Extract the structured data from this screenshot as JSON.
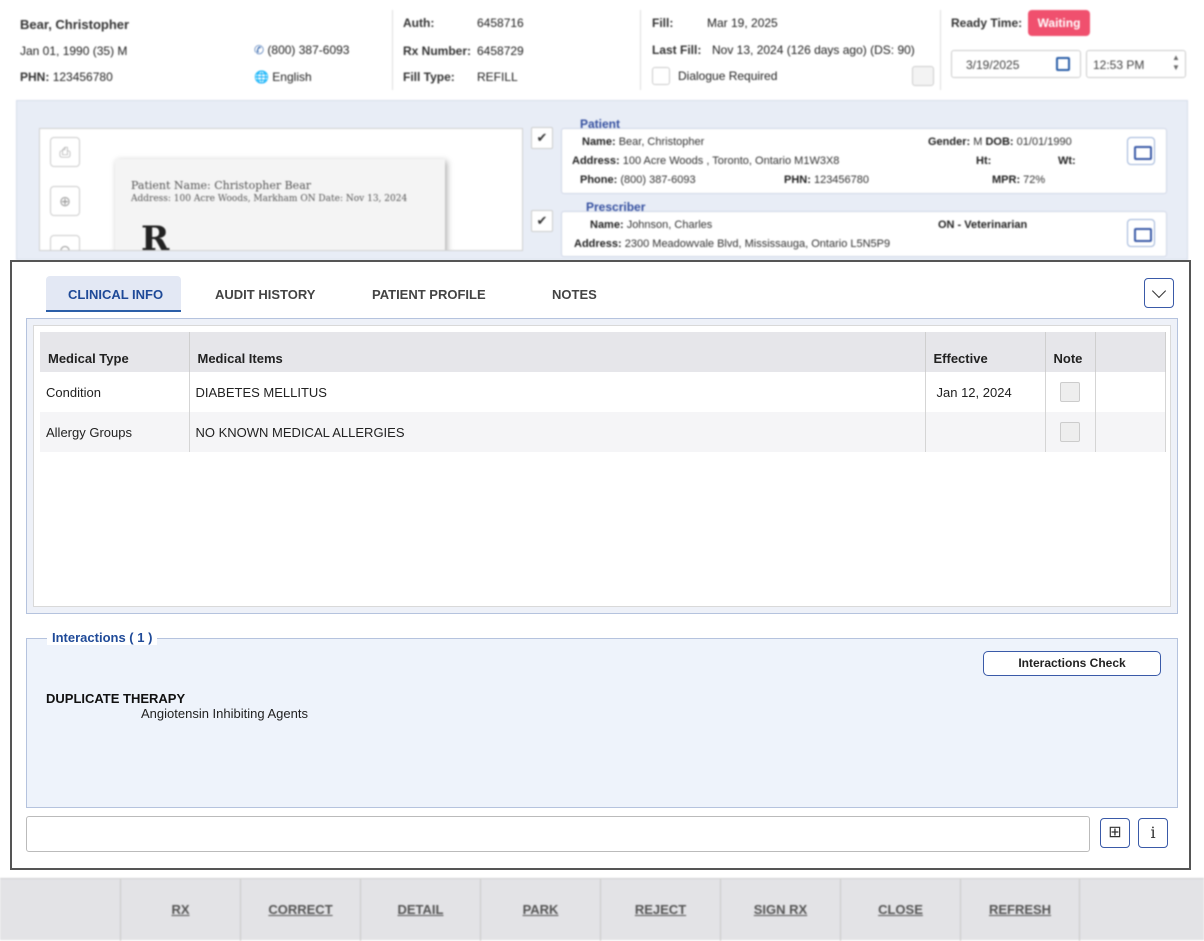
{
  "header": {
    "patient_name": "Bear, Christopher",
    "dob_line": "Jan 01, 1990 (35) M",
    "phn_label": "PHN:",
    "phn_value": "123456780",
    "phone": "(800) 387-6093",
    "language": "English",
    "auth_label": "Auth:",
    "auth_value": "6458716",
    "rx_label": "Rx Number:",
    "rx_value": "6458729",
    "filltype_label": "Fill Type:",
    "filltype_value": "REFILL",
    "fill_label": "Fill:",
    "fill_value": "Mar 19, 2025",
    "lastfill_label": "Last Fill:",
    "lastfill_value": "Nov 13, 2024 (126 days ago) (DS: 90)",
    "dialogue_label": "Dialogue Required",
    "ready_label": "Ready Time:",
    "ready_status": "Waiting",
    "ready_date": "3/19/2025",
    "ready_time": "12:53 PM"
  },
  "preview": {
    "scan_line1": "Patient Name: Christopher Bear",
    "scan_line2": "Address: 100 Acre Woods, Markham ON        Date: Nov 13, 2024",
    "scan_big": "R",
    "patient_title": "Patient",
    "p_name_label": "Name:",
    "p_name": "Bear, Christopher",
    "p_gender_label": "Gender:",
    "p_gender": "M",
    "p_dob_label": "DOB:",
    "p_dob": "01/01/1990",
    "p_address_label": "Address:",
    "p_address": "100 Acre Woods , Toronto, Ontario M1W3X8",
    "p_ht_label": "Ht:",
    "p_wt_label": "Wt:",
    "p_phone_label": "Phone:",
    "p_phone": "(800) 387-6093",
    "p_phn_label": "PHN:",
    "p_phn": "123456780",
    "p_mpr_label": "MPR:",
    "p_mpr": "72%",
    "prescriber_title": "Prescriber",
    "pr_name_label": "Name:",
    "pr_name": "Johnson, Charles",
    "pr_type": "ON - Veterinarian",
    "pr_address_label": "Address:",
    "pr_address": "2300 Meadowvale Blvd, Mississauga, Ontario L5N5P9"
  },
  "tabs": [
    "CLINICAL INFO",
    "AUDIT HISTORY",
    "PATIENT PROFILE",
    "NOTES"
  ],
  "table": {
    "headers": [
      "Medical Type",
      "Medical Items",
      "Effective",
      "Note",
      ""
    ],
    "rows": [
      {
        "type": "Condition",
        "item": "DIABETES MELLITUS",
        "effective": "Jan 12, 2024"
      },
      {
        "type": "Allergy Groups",
        "item": "NO KNOWN MEDICAL ALLERGIES",
        "effective": ""
      }
    ]
  },
  "interactions": {
    "title": "Interactions ( 1 )",
    "check_label": "Interactions Check",
    "type": "DUPLICATE THERAPY",
    "detail": "Angiotensin Inhibiting Agents"
  },
  "footer": [
    "RX",
    "CORRECT",
    "DETAIL",
    "PARK",
    "REJECT",
    "SIGN RX",
    "CLOSE",
    "REFRESH"
  ],
  "colors": {
    "accent": "#2a5ea8",
    "waiting": "#f0506e",
    "tab_active_bg": "#e3e8f4"
  }
}
